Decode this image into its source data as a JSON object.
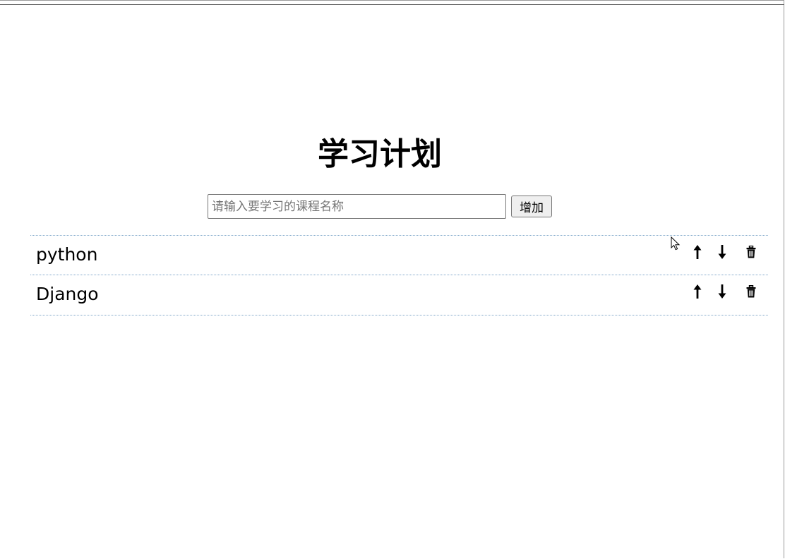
{
  "page": {
    "title": "学习计划"
  },
  "add_form": {
    "input_placeholder": "请输入要学习的课程名称",
    "input_value": "",
    "add_label": "增加"
  },
  "courses": [
    {
      "name": "python"
    },
    {
      "name": "Django"
    }
  ],
  "icons": {
    "move_up": "arrow-up-icon",
    "move_down": "arrow-down-icon",
    "delete": "trash-icon"
  }
}
